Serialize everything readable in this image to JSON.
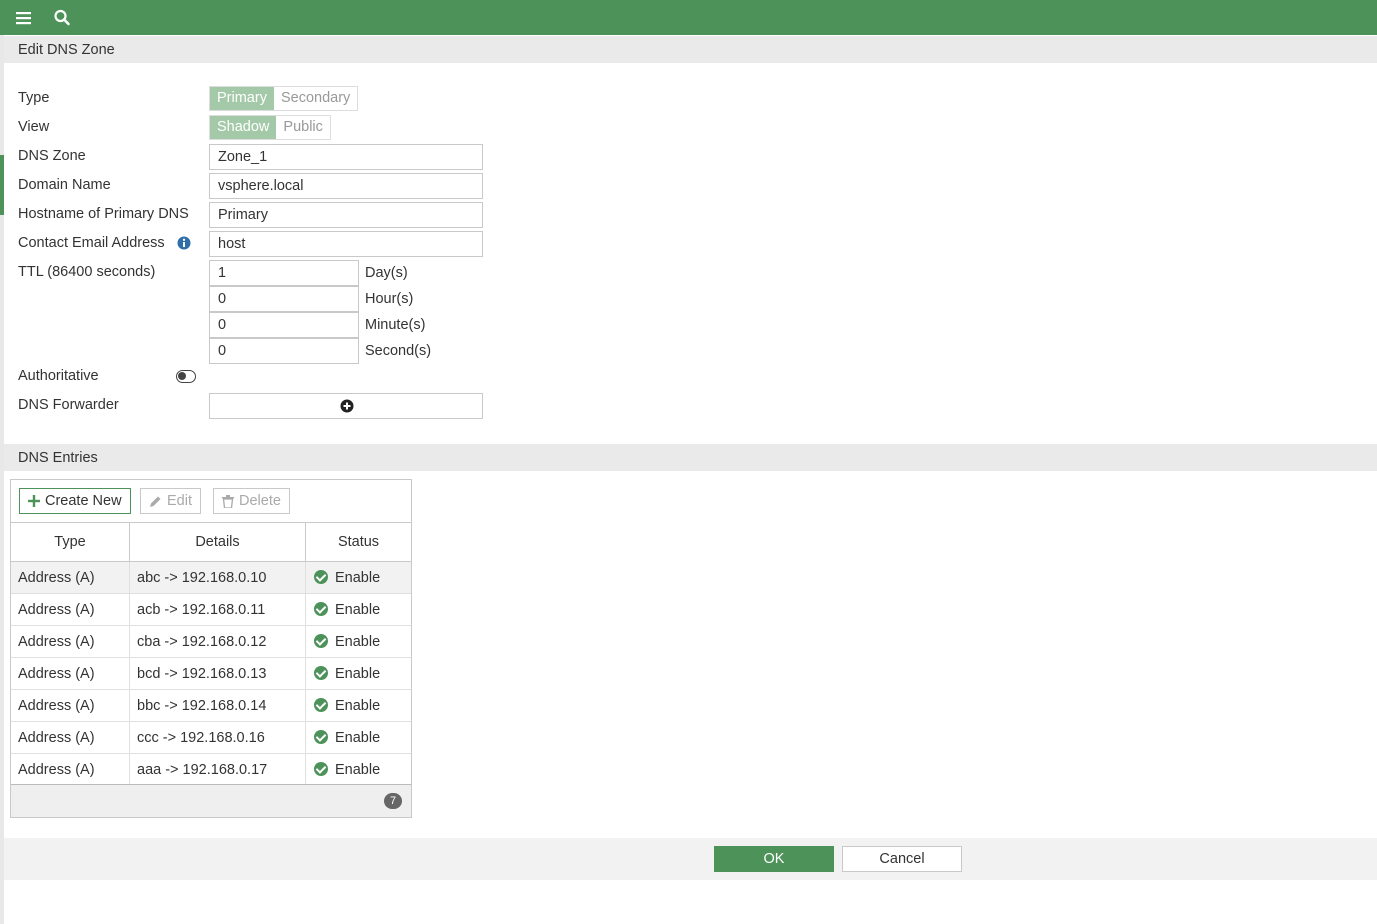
{
  "header": {
    "title": "Edit DNS Zone"
  },
  "form": {
    "type_label": "Type",
    "type_options": [
      "Primary",
      "Secondary"
    ],
    "type_selected": "Primary",
    "view_label": "View",
    "view_options": [
      "Shadow",
      "Public"
    ],
    "view_selected": "Shadow",
    "dns_zone_label": "DNS Zone",
    "dns_zone_value": "Zone_1",
    "domain_name_label": "Domain Name",
    "domain_name_value": "vsphere.local",
    "primary_dns_label": "Hostname of Primary DNS",
    "primary_dns_value": "Primary",
    "contact_email_label": "Contact Email Address",
    "contact_email_value": "host",
    "ttl_label": "TTL (86400 seconds)",
    "ttl_days": "1",
    "ttl_days_unit": "Day(s)",
    "ttl_hours": "0",
    "ttl_hours_unit": "Hour(s)",
    "ttl_minutes": "0",
    "ttl_minutes_unit": "Minute(s)",
    "ttl_seconds": "0",
    "ttl_seconds_unit": "Second(s)",
    "authoritative_label": "Authoritative",
    "authoritative_on": false,
    "forwarder_label": "DNS Forwarder"
  },
  "entries": {
    "title": "DNS Entries",
    "create_label": "Create New",
    "edit_label": "Edit",
    "delete_label": "Delete",
    "columns": [
      "Type",
      "Details",
      "Status"
    ],
    "rows": [
      {
        "type": "Address (A)",
        "details": "abc -> 192.168.0.10",
        "status": "Enable"
      },
      {
        "type": "Address (A)",
        "details": "acb -> 192.168.0.11",
        "status": "Enable"
      },
      {
        "type": "Address (A)",
        "details": "cba -> 192.168.0.12",
        "status": "Enable"
      },
      {
        "type": "Address (A)",
        "details": "bcd -> 192.168.0.13",
        "status": "Enable"
      },
      {
        "type": "Address (A)",
        "details": "bbc -> 192.168.0.14",
        "status": "Enable"
      },
      {
        "type": "Address (A)",
        "details": "ccc -> 192.168.0.16",
        "status": "Enable"
      },
      {
        "type": "Address (A)",
        "details": "aaa -> 192.168.0.17",
        "status": "Enable"
      }
    ],
    "count": "7"
  },
  "footer": {
    "ok_label": "OK",
    "cancel_label": "Cancel"
  },
  "colors": {
    "accent": "#4d9359",
    "segment_active": "#a3c9a8",
    "info_icon": "#2f6fa8"
  },
  "icons": [
    "menu-icon",
    "search-icon",
    "info-icon",
    "add-circle-icon",
    "plus-icon",
    "pencil-icon",
    "trash-icon",
    "check-circle-icon"
  ]
}
